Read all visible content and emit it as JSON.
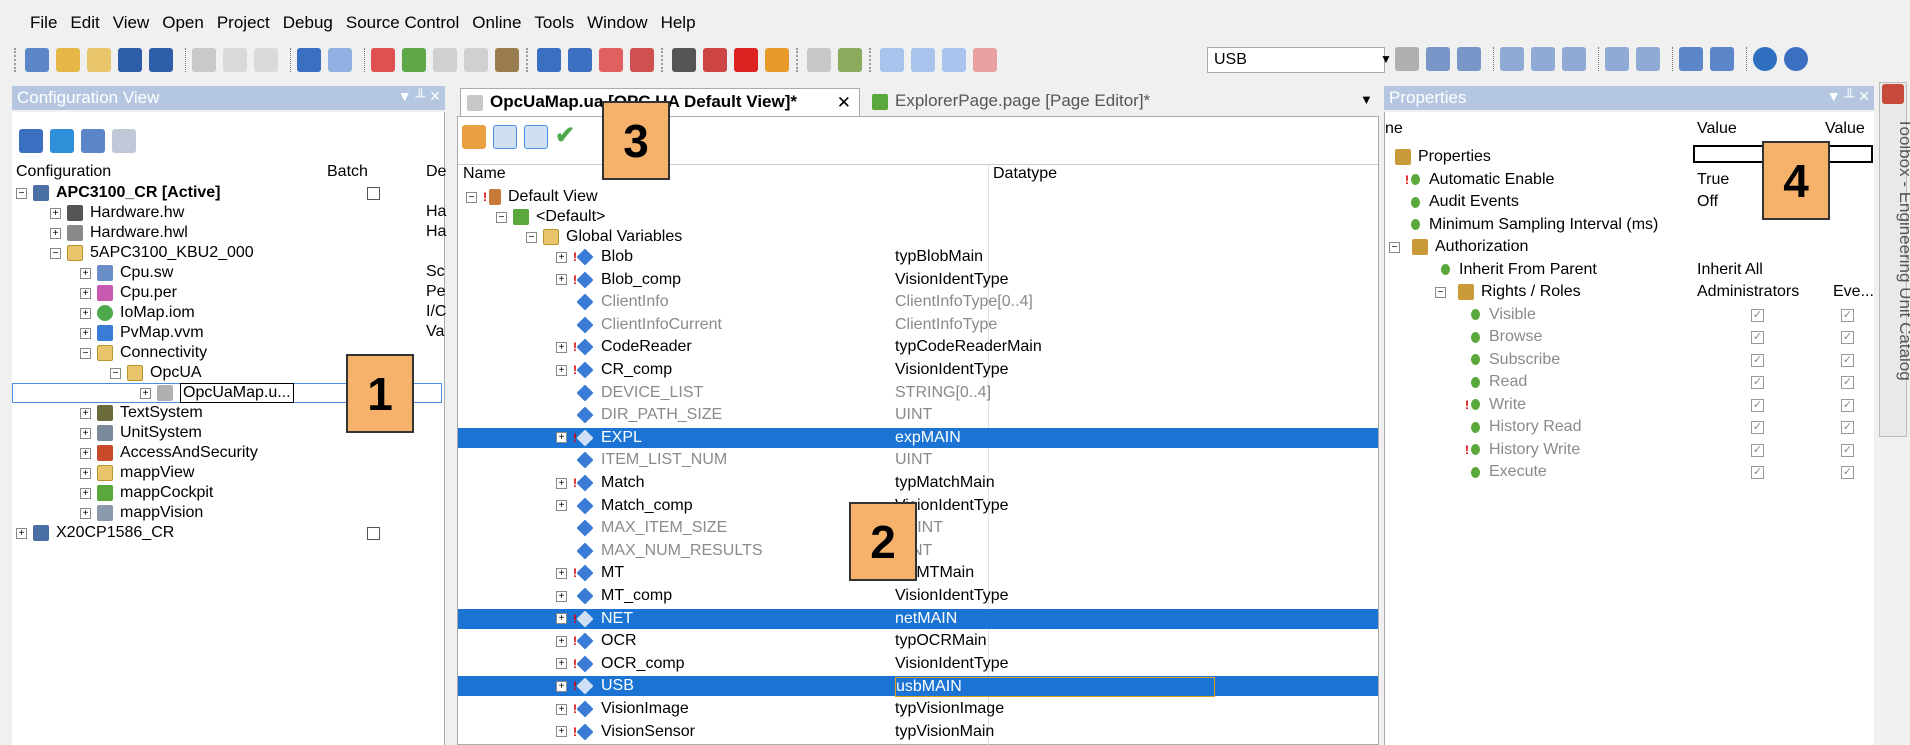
{
  "menu": [
    "File",
    "Edit",
    "View",
    "Open",
    "Project",
    "Debug",
    "Source Control",
    "Online",
    "Tools",
    "Window",
    "Help"
  ],
  "toolbar": {
    "target_combo": "USB"
  },
  "config_view": {
    "title": "Configuration View",
    "columns": {
      "configuration": "Configuration",
      "batch": "Batch",
      "desc": "De"
    },
    "rows": [
      {
        "label": "APC3100_CR [Active]",
        "desc": ""
      },
      {
        "label": "Hardware.hw",
        "desc": "Ha"
      },
      {
        "label": "Hardware.hwl",
        "desc": "Ha"
      },
      {
        "label": "5APC3100_KBU2_000",
        "desc": ""
      },
      {
        "label": "Cpu.sw",
        "desc": "Sc"
      },
      {
        "label": "Cpu.per",
        "desc": "Pe"
      },
      {
        "label": "IoMap.iom",
        "desc": "I/C"
      },
      {
        "label": "PvMap.vvm",
        "desc": "Va"
      },
      {
        "label": "Connectivity",
        "desc": ""
      },
      {
        "label": "OpcUA",
        "desc": ""
      },
      {
        "label": "OpcUaMap.u...",
        "desc": ""
      },
      {
        "label": "TextSystem",
        "desc": ""
      },
      {
        "label": "UnitSystem",
        "desc": ""
      },
      {
        "label": "AccessAndSecurity",
        "desc": ""
      },
      {
        "label": "mappView",
        "desc": ""
      },
      {
        "label": "mappCockpit",
        "desc": ""
      },
      {
        "label": "mappVision",
        "desc": ""
      },
      {
        "label": "X20CP1586_CR",
        "desc": ""
      }
    ]
  },
  "editor": {
    "tabs": [
      {
        "label": "OpcUaMap.ua [OPC UA Default View]*"
      },
      {
        "label": "ExplorerPage.page [Page Editor]*"
      }
    ],
    "columns": {
      "name": "Name",
      "datatype": "Datatype"
    },
    "rows": [
      {
        "name": "Default View",
        "type": ""
      },
      {
        "name": "<Default>",
        "type": ""
      },
      {
        "name": "Global Variables",
        "type": ""
      },
      {
        "name": "Blob",
        "type": "typBlobMain"
      },
      {
        "name": "Blob_comp",
        "type": "VisionIdentType"
      },
      {
        "name": "ClientInfo",
        "type": "ClientInfoType[0..4]"
      },
      {
        "name": "ClientInfoCurrent",
        "type": "ClientInfoType"
      },
      {
        "name": "CodeReader",
        "type": "typCodeReaderMain"
      },
      {
        "name": "CR_comp",
        "type": "VisionIdentType"
      },
      {
        "name": "DEVICE_LIST",
        "type": "STRING[0..4]"
      },
      {
        "name": "DIR_PATH_SIZE",
        "type": "UINT"
      },
      {
        "name": "EXPL",
        "type": "expMAIN"
      },
      {
        "name": "ITEM_LIST_NUM",
        "type": "UINT"
      },
      {
        "name": "Match",
        "type": "typMatchMain"
      },
      {
        "name": "Match_comp",
        "type": "VisionIdentType"
      },
      {
        "name": "MAX_ITEM_SIZE",
        "type": "USINT"
      },
      {
        "name": "MAX_NUM_RESULTS",
        "type": "UINT"
      },
      {
        "name": "MT",
        "type": "typMTMain"
      },
      {
        "name": "MT_comp",
        "type": "VisionIdentType"
      },
      {
        "name": "NET",
        "type": "netMAIN"
      },
      {
        "name": "OCR",
        "type": "typOCRMain"
      },
      {
        "name": "OCR_comp",
        "type": "VisionIdentType"
      },
      {
        "name": "USB",
        "type": "usbMAIN"
      },
      {
        "name": "VisionImage",
        "type": "typVisionImage"
      },
      {
        "name": "VisionSensor",
        "type": "typVisionMain"
      }
    ]
  },
  "properties": {
    "title": "Properties",
    "columns": {
      "name": "ne",
      "value": "Value",
      "value2": "Value"
    },
    "rows": [
      {
        "label": "Properties",
        "v1": "",
        "v2": ""
      },
      {
        "label": "Automatic Enable",
        "v1": "True",
        "v2": ""
      },
      {
        "label": "Audit Events",
        "v1": "Off",
        "v2": ""
      },
      {
        "label": "Minimum Sampling Interval (ms)",
        "v1": "",
        "v2": ""
      },
      {
        "label": "Authorization",
        "v1": "",
        "v2": ""
      },
      {
        "label": "Inherit From Parent",
        "v1": "Inherit All",
        "v2": ""
      },
      {
        "label": "Rights / Roles",
        "v1": "Administrators",
        "v2": "Eve..."
      },
      {
        "label": "Visible",
        "v1": "",
        "v2": ""
      },
      {
        "label": "Browse",
        "v1": "",
        "v2": ""
      },
      {
        "label": "Subscribe",
        "v1": "",
        "v2": ""
      },
      {
        "label": "Read",
        "v1": "",
        "v2": ""
      },
      {
        "label": "Write",
        "v1": "",
        "v2": ""
      },
      {
        "label": "History Read",
        "v1": "",
        "v2": ""
      },
      {
        "label": "History Write",
        "v1": "",
        "v2": ""
      },
      {
        "label": "Execute",
        "v1": "",
        "v2": ""
      }
    ]
  },
  "side_tab": "Toolbox - Engineering Unit Catalog",
  "callouts": [
    "1",
    "2",
    "3",
    "4"
  ]
}
